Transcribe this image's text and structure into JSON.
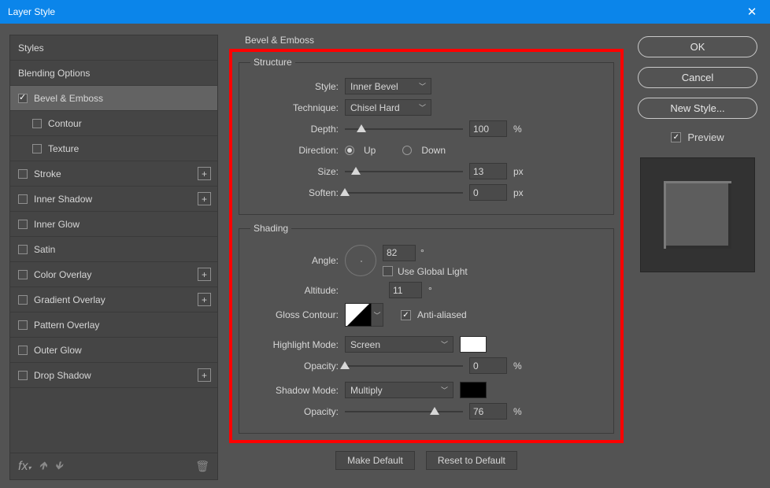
{
  "window": {
    "title": "Layer Style"
  },
  "left": {
    "header": "Styles",
    "blending": "Blending Options",
    "items": [
      {
        "label": "Bevel & Emboss",
        "checked": true,
        "selected": true,
        "plus": false,
        "indent": false
      },
      {
        "label": "Contour",
        "checked": false,
        "selected": false,
        "plus": false,
        "indent": true
      },
      {
        "label": "Texture",
        "checked": false,
        "selected": false,
        "plus": false,
        "indent": true
      },
      {
        "label": "Stroke",
        "checked": false,
        "selected": false,
        "plus": true,
        "indent": false
      },
      {
        "label": "Inner Shadow",
        "checked": false,
        "selected": false,
        "plus": true,
        "indent": false
      },
      {
        "label": "Inner Glow",
        "checked": false,
        "selected": false,
        "plus": false,
        "indent": false
      },
      {
        "label": "Satin",
        "checked": false,
        "selected": false,
        "plus": false,
        "indent": false
      },
      {
        "label": "Color Overlay",
        "checked": false,
        "selected": false,
        "plus": true,
        "indent": false
      },
      {
        "label": "Gradient Overlay",
        "checked": false,
        "selected": false,
        "plus": true,
        "indent": false
      },
      {
        "label": "Pattern Overlay",
        "checked": false,
        "selected": false,
        "plus": false,
        "indent": false
      },
      {
        "label": "Outer Glow",
        "checked": false,
        "selected": false,
        "plus": false,
        "indent": false
      },
      {
        "label": "Drop Shadow",
        "checked": false,
        "selected": false,
        "plus": true,
        "indent": false
      }
    ],
    "fx_label": "fx"
  },
  "panel_title": "Bevel & Emboss",
  "structure": {
    "legend": "Structure",
    "style_label": "Style:",
    "style_value": "Inner Bevel",
    "technique_label": "Technique:",
    "technique_value": "Chisel Hard",
    "depth_label": "Depth:",
    "depth_value": "100",
    "depth_unit": "%",
    "direction_label": "Direction:",
    "up_label": "Up",
    "down_label": "Down",
    "direction": "up",
    "size_label": "Size:",
    "size_value": "13",
    "size_unit": "px",
    "soften_label": "Soften:",
    "soften_value": "0",
    "soften_unit": "px"
  },
  "shading": {
    "legend": "Shading",
    "angle_label": "Angle:",
    "angle_value": "82",
    "angle_unit": "°",
    "global_light_label": "Use Global Light",
    "global_light": false,
    "altitude_label": "Altitude:",
    "altitude_value": "11",
    "altitude_unit": "°",
    "gloss_label": "Gloss Contour:",
    "antialias_label": "Anti-aliased",
    "antialias": true,
    "highlight_mode_label": "Highlight Mode:",
    "highlight_mode_value": "Screen",
    "highlight_opacity_label": "Opacity:",
    "highlight_opacity_value": "0",
    "highlight_opacity_unit": "%",
    "shadow_mode_label": "Shadow Mode:",
    "shadow_mode_value": "Multiply",
    "shadow_opacity_label": "Opacity:",
    "shadow_opacity_value": "76",
    "shadow_opacity_unit": "%",
    "highlight_color": "#ffffff",
    "shadow_color": "#000000"
  },
  "buttons": {
    "make_default": "Make Default",
    "reset_default": "Reset to Default"
  },
  "right": {
    "ok": "OK",
    "cancel": "Cancel",
    "new_style": "New Style...",
    "preview_label": "Preview",
    "preview": true
  }
}
